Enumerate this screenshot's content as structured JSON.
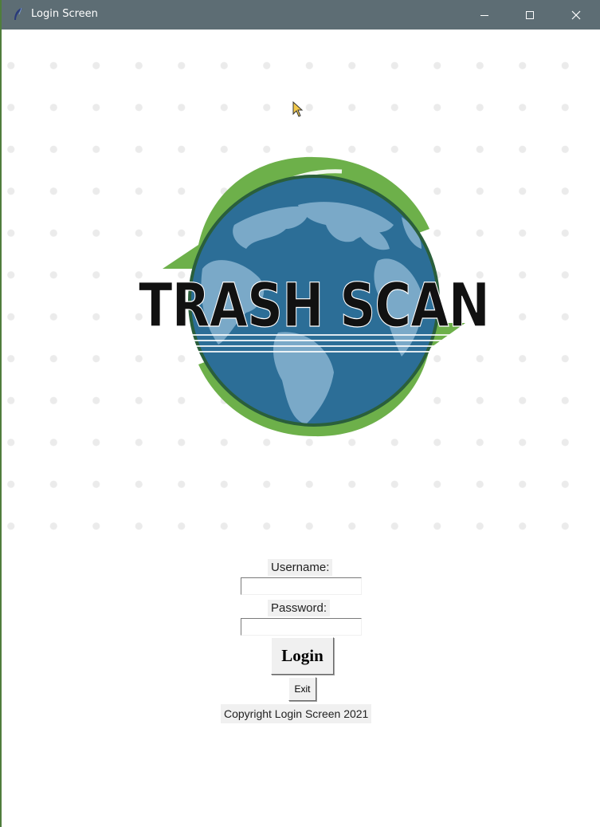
{
  "window": {
    "title": "Login Screen",
    "controls": {
      "minimize": "minimize",
      "maximize": "maximize",
      "close": "close"
    }
  },
  "logo": {
    "text": "TRASH SCAN",
    "colors": {
      "ocean": "#2c6e97",
      "land": "#7aa9c8",
      "arrows": "#6db04a",
      "text": "#111111"
    }
  },
  "form": {
    "username_label": "Username:",
    "username_value": "",
    "password_label": "Password:",
    "password_value": "",
    "login_label": "Login",
    "exit_label": "Exit"
  },
  "footer": {
    "copyright": "Copyright Login Screen 2021"
  },
  "theme": {
    "titlebar": "#5d6d74",
    "label_bg": "#f0f0f0",
    "dot_color": "#ebebeb"
  }
}
